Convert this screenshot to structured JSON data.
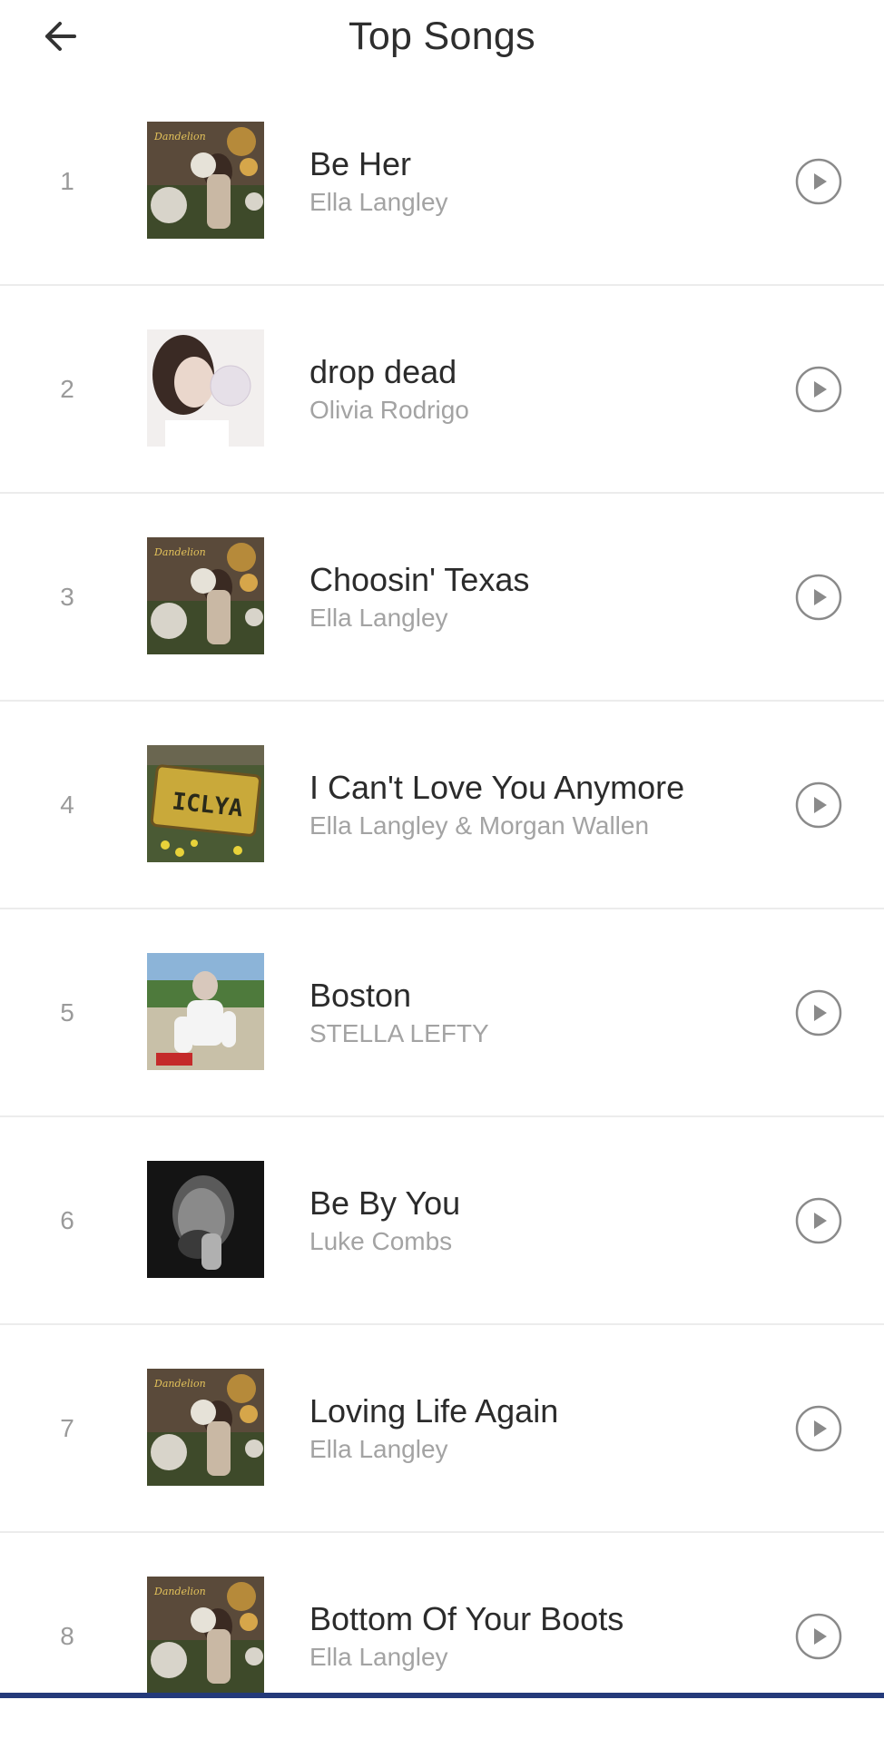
{
  "header": {
    "title": "Top Songs",
    "back_icon": "arrow-left-icon"
  },
  "colors": {
    "background": "#ffffff",
    "title_text": "#2e2e2e",
    "secondary_text": "#a3a3a3",
    "divider": "#ececec",
    "play_icon": "#8a8a8a",
    "bottom_bar": "#243a7a"
  },
  "songs": [
    {
      "rank": "1",
      "title": "Be Her",
      "artist": "Ella Langley",
      "cover": "album-cover-dandelion"
    },
    {
      "rank": "2",
      "title": "drop dead",
      "artist": "Olivia Rodrigo",
      "cover": "album-cover-bubblegum"
    },
    {
      "rank": "3",
      "title": "Choosin' Texas",
      "artist": "Ella Langley",
      "cover": "album-cover-dandelion"
    },
    {
      "rank": "4",
      "title": "I Can't Love You Anymore",
      "artist": "Ella Langley & Morgan Wallen",
      "cover": "album-cover-license-plate"
    },
    {
      "rank": "5",
      "title": "Boston",
      "artist": "STELLA LEFTY",
      "cover": "album-cover-field"
    },
    {
      "rank": "6",
      "title": "Be By You",
      "artist": "Luke Combs",
      "cover": "album-cover-portrait-bw"
    },
    {
      "rank": "7",
      "title": "Loving Life Again",
      "artist": "Ella Langley",
      "cover": "album-cover-dandelion"
    },
    {
      "rank": "8",
      "title": "Bottom Of Your Boots",
      "artist": "Ella Langley",
      "cover": "album-cover-dandelion"
    }
  ]
}
